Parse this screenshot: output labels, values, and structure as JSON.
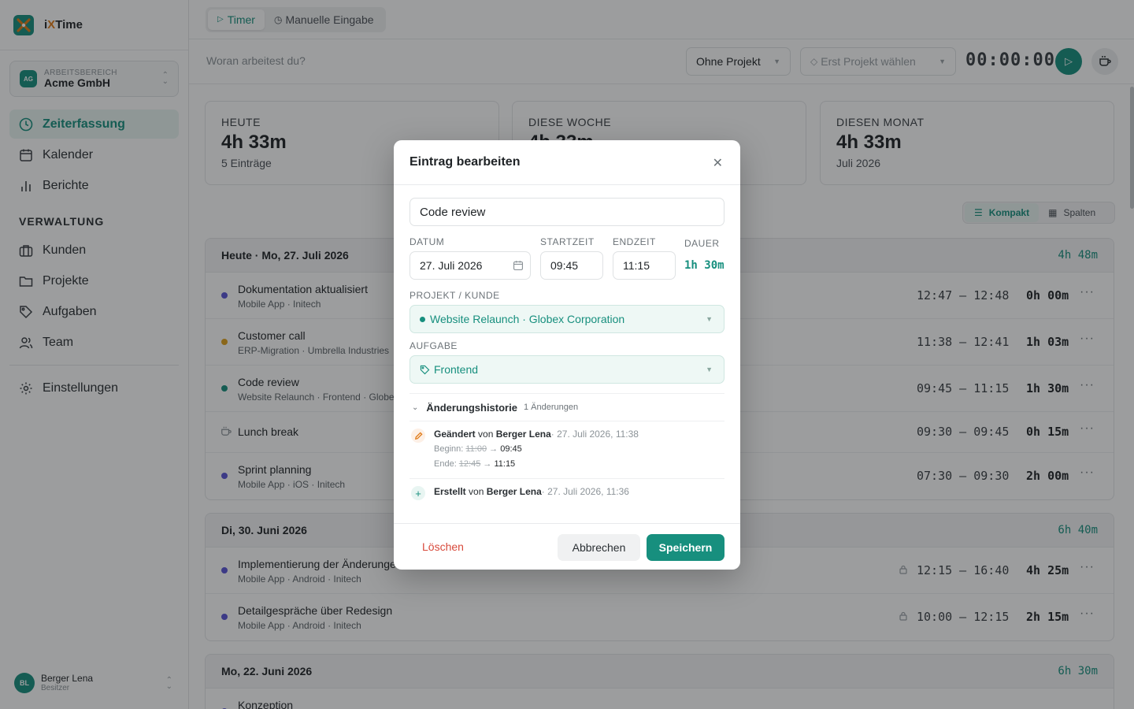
{
  "app": {
    "name_prefix": "i",
    "name_x": "X",
    "name_suffix": "Time",
    "accent": "#178f7e"
  },
  "workspace": {
    "label": "ARBEITSBEREICH",
    "name": "Acme GmbH",
    "initials": "AG"
  },
  "nav": {
    "items": [
      {
        "label": "Zeiterfassung",
        "icon": "clock-icon"
      },
      {
        "label": "Kalender",
        "icon": "calendar-icon"
      },
      {
        "label": "Berichte",
        "icon": "bar-chart-icon"
      }
    ],
    "section": "VERWALTUNG",
    "admin": [
      {
        "label": "Kunden",
        "icon": "briefcase-icon"
      },
      {
        "label": "Projekte",
        "icon": "folder-icon"
      },
      {
        "label": "Aufgaben",
        "icon": "tag-icon"
      },
      {
        "label": "Team",
        "icon": "users-icon"
      }
    ],
    "settings": "Einstellungen"
  },
  "user": {
    "name": "Berger Lena",
    "role": "Besitzer",
    "initials": "BL"
  },
  "topbar": {
    "tab_timer": "Timer",
    "tab_manual": "Manuelle Eingabe"
  },
  "timer": {
    "placeholder": "Woran arbeitest du?",
    "project_select": "Ohne Projekt",
    "task_select": "Erst Projekt wählen",
    "clock": "00:00:00"
  },
  "stats": [
    {
      "label": "HEUTE",
      "value": "4h 33m",
      "sub": "5 Einträge"
    },
    {
      "label": "DIESE WOCHE",
      "value": "4h 33m",
      "sub": ""
    },
    {
      "label": "DIESEN MONAT",
      "value": "4h 33m",
      "sub": "Juli 2026"
    }
  ],
  "view_toggle": {
    "compact": "Kompakt",
    "columns": "Spalten"
  },
  "groups": [
    {
      "title": "Heute · Mo, 27. Juli 2026",
      "total": "4h 48m",
      "entries": [
        {
          "title": "Dokumentation aktualisiert",
          "sub": "Mobile App · Initech",
          "range": "12:47 – 12:48",
          "dur": "0h 00m",
          "color": "#5b55d6"
        },
        {
          "title": "Customer call",
          "sub": "ERP-Migration · Umbrella Industries",
          "range": "11:38 – 12:41",
          "dur": "1h 03m",
          "color": "#e0a21c"
        },
        {
          "title": "Code review",
          "sub": "Website Relaunch · Frontend · Globex",
          "range": "09:45 – 11:15",
          "dur": "1h 30m",
          "color": "#178f7e"
        },
        {
          "title": "Lunch break",
          "sub": "",
          "range": "09:30 – 09:45",
          "dur": "0h 15m",
          "color": ""
        },
        {
          "title": "Sprint planning",
          "sub": "Mobile App · iOS · Initech",
          "range": "07:30 – 09:30",
          "dur": "2h 00m",
          "color": "#5b55d6"
        }
      ]
    },
    {
      "title": "Di, 30. Juni 2026",
      "total": "6h 40m",
      "entries": [
        {
          "title": "Implementierung der Änderungen",
          "sub": "Mobile App · Android · Initech",
          "range": "12:15 – 16:40",
          "dur": "4h 25m",
          "color": "#5b55d6"
        },
        {
          "title": "Detailgespräche über Redesign",
          "sub": "Mobile App · Android · Initech",
          "range": "10:00 – 12:15",
          "dur": "2h 15m",
          "color": "#5b55d6"
        }
      ]
    },
    {
      "title": "Mo, 22. Juni 2026",
      "total": "6h 30m",
      "entries": [
        {
          "title": "Konzeption",
          "sub": "",
          "range": "",
          "dur": "",
          "color": "#5b55d6"
        }
      ]
    }
  ],
  "modal": {
    "title": "Eintrag bearbeiten",
    "description": "Code review",
    "date_label": "DATUM",
    "date_value": "27. Juli 2026",
    "start_label": "STARTZEIT",
    "start_value": "09:45",
    "end_label": "ENDZEIT",
    "end_value": "11:15",
    "duration_label": "DAUER",
    "duration_value": "1h 30m",
    "project_label": "PROJEKT / KUNDE",
    "project_value": "Website Relaunch · Globex Corporation",
    "task_label": "AUFGABE",
    "task_value": "Frontend",
    "history_title": "Änderungshistorie",
    "history_count": "1 Änderungen",
    "history": {
      "changed_action": "Geändert",
      "changed_by": "von",
      "changed_user": "Berger Lena",
      "changed_time": "· 27. Juli 2026, 11:38",
      "begin_label": "Beginn:",
      "begin_old": "11:00",
      "begin_new": "09:45",
      "end_label": "Ende:",
      "end_old": "12:45",
      "end_new": "11:15",
      "created_action": "Erstellt",
      "created_by": "von",
      "created_user": "Berger Lena",
      "created_time": "· 27. Juli 2026, 11:36"
    },
    "delete": "Löschen",
    "cancel": "Abbrechen",
    "save": "Speichern"
  }
}
